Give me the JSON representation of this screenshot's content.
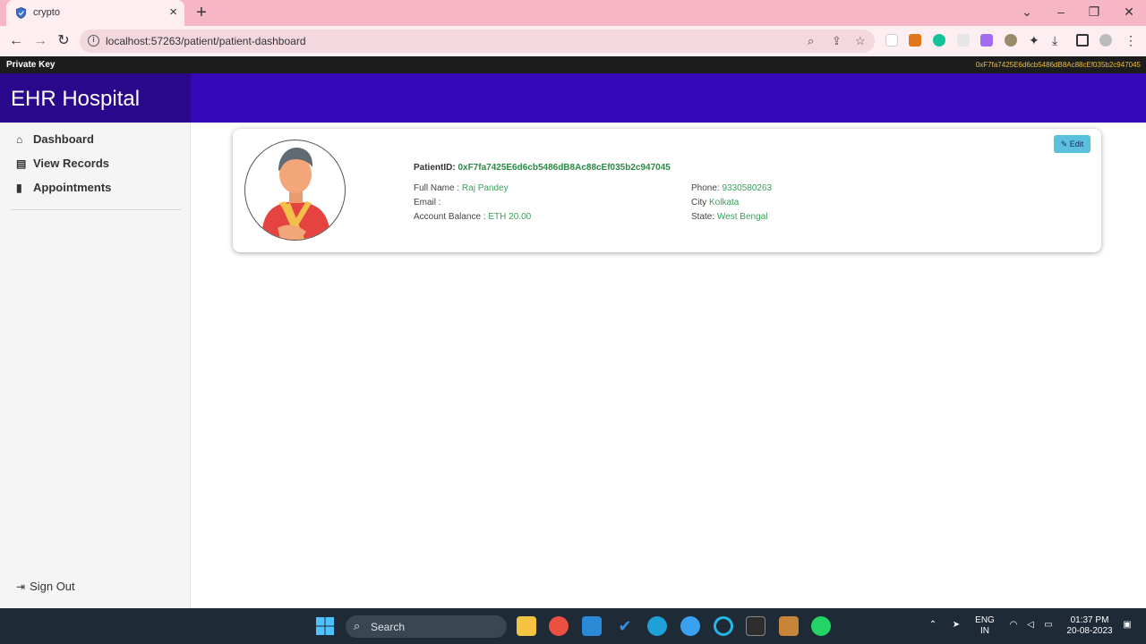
{
  "browser": {
    "tab_title": "crypto",
    "url": "localhost:57263/patient/patient-dashboard"
  },
  "keybar": {
    "label": "Private Key",
    "value": "0xF7fa7425E6d6cb5486dB8Ac88cEf035b2c947045"
  },
  "header": {
    "brand": "EHR Hospital"
  },
  "sidebar": {
    "items": [
      {
        "label": "Dashboard",
        "icon": "home-icon"
      },
      {
        "label": "View Records",
        "icon": "file-icon"
      },
      {
        "label": "Appointments",
        "icon": "clipboard-icon"
      }
    ],
    "signout_label": "Sign Out"
  },
  "profile": {
    "edit_label": "Edit",
    "patient_id_label": "PatientID:",
    "patient_id": "0xF7fa7425E6d6cb5486dB8Ac88cEf035b2c947045",
    "full_name_label": "Full Name :",
    "full_name": "Raj Pandey",
    "email_label": "Email :",
    "email": "",
    "balance_label": "Account Balance :",
    "balance": "ETH 20.00",
    "phone_label": "Phone:",
    "phone": "9330580263",
    "city_label": "City",
    "city": "Kolkata",
    "state_label": "State:",
    "state": "West Bengal"
  },
  "taskbar": {
    "search_label": "Search",
    "lang_line1": "ENG",
    "lang_line2": "IN",
    "time": "01:37 PM",
    "date": "20-08-2023"
  },
  "colors": {
    "header": "#3508b8",
    "brand_bg": "#2a088c",
    "value_green": "#3aa05a",
    "edit_button": "#5bc0de"
  }
}
